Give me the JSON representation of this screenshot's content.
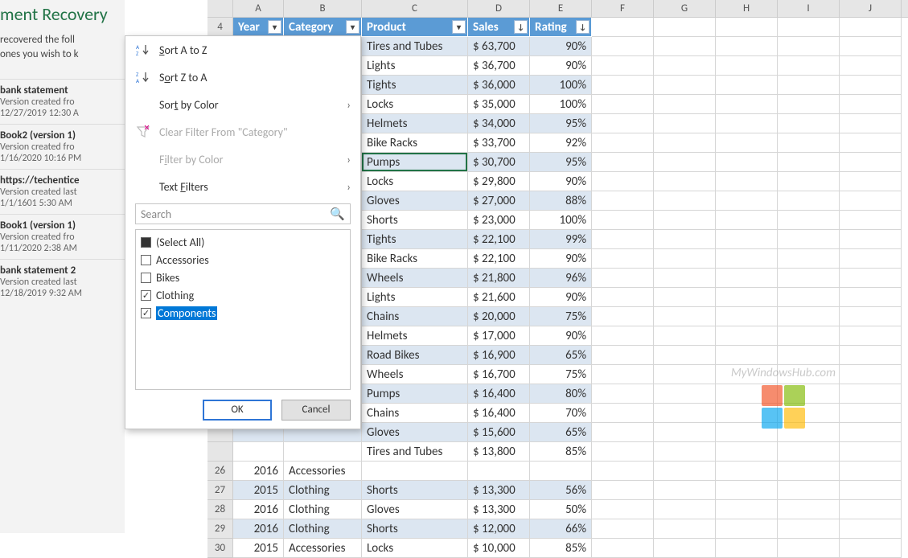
{
  "recovery": {
    "title": "ment Recovery",
    "desc1": "recovered the foll",
    "desc2": "ones you wish to k",
    "items": [
      {
        "title": "bank statement",
        "sub": "Version created fro",
        "date": "12/27/2019 12:30 A"
      },
      {
        "title": "Book2 (version 1)",
        "sub": "Version created fro",
        "date": "1/16/2020 10:16 PM"
      },
      {
        "title": "https://techentice",
        "sub": "Version created last",
        "date": "1/1/1601 5:30 AM"
      },
      {
        "title": "Book1 (version 1)",
        "sub": "Version created fro",
        "date": "1/11/2020 2:38 AM"
      },
      {
        "title": "bank statement 2",
        "sub": "Version created last",
        "date": "12/18/2019 9:32 AM"
      }
    ]
  },
  "columns_letters": [
    "A",
    "B",
    "C",
    "D",
    "E",
    "F",
    "G",
    "H",
    "I",
    "J"
  ],
  "headers": {
    "row_num": "4",
    "year": "Year",
    "category": "Category",
    "product": "Product",
    "sales": "Sales",
    "rating": "Rating"
  },
  "table_rows": [
    {
      "product": "Tires and Tubes",
      "sales": "$ 63,700",
      "rating": "90%"
    },
    {
      "product": "Lights",
      "sales": "$ 36,700",
      "rating": "90%"
    },
    {
      "product": "Tights",
      "sales": "$ 36,000",
      "rating": "100%"
    },
    {
      "product": "Locks",
      "sales": "$ 35,000",
      "rating": "100%"
    },
    {
      "product": "Helmets",
      "sales": "$ 34,000",
      "rating": "95%"
    },
    {
      "product": "Bike Racks",
      "sales": "$ 33,700",
      "rating": "92%"
    },
    {
      "product": "Pumps",
      "sales": "$ 30,700",
      "rating": "95%"
    },
    {
      "product": "Locks",
      "sales": "$ 29,800",
      "rating": "90%"
    },
    {
      "product": "Gloves",
      "sales": "$ 27,000",
      "rating": "88%"
    },
    {
      "product": "Shorts",
      "sales": "$ 23,000",
      "rating": "100%"
    },
    {
      "product": "Tights",
      "sales": "$ 22,100",
      "rating": "99%"
    },
    {
      "product": "Bike Racks",
      "sales": "$ 22,100",
      "rating": "90%"
    },
    {
      "product": "Wheels",
      "sales": "$ 21,800",
      "rating": "96%"
    },
    {
      "product": "Lights",
      "sales": "$ 21,600",
      "rating": "90%"
    },
    {
      "product": "Chains",
      "sales": "$ 20,000",
      "rating": "75%"
    },
    {
      "product": "Helmets",
      "sales": "$ 17,000",
      "rating": "90%"
    },
    {
      "product": "Road Bikes",
      "sales": "$ 16,900",
      "rating": "65%"
    },
    {
      "product": "Wheels",
      "sales": "$ 16,700",
      "rating": "75%"
    },
    {
      "product": "Pumps",
      "sales": "$ 16,400",
      "rating": "80%"
    },
    {
      "product": "Chains",
      "sales": "$ 16,400",
      "rating": "70%"
    },
    {
      "product": "Gloves",
      "sales": "$ 15,600",
      "rating": "65%"
    },
    {
      "product": "Tires and Tubes",
      "sales": "$ 13,800",
      "rating": "85%"
    }
  ],
  "visible_full_rows": [
    {
      "rownum": "26",
      "year": "2016",
      "category": "Accessories",
      "product": "",
      "sales": "",
      "rating": ""
    },
    {
      "rownum": "27",
      "year": "2015",
      "category": "Clothing",
      "product": "Shorts",
      "sales": "$ 13,300",
      "rating": "56%"
    },
    {
      "rownum": "28",
      "year": "2016",
      "category": "Clothing",
      "product": "Gloves",
      "sales": "$ 13,300",
      "rating": "50%"
    },
    {
      "rownum": "29",
      "year": "2016",
      "category": "Clothing",
      "product": "Shorts",
      "sales": "$ 12,000",
      "rating": "66%"
    },
    {
      "rownum": "30",
      "year": "2015",
      "category": "Accessories",
      "product": "Locks",
      "sales": "$ 10,000",
      "rating": "85%"
    }
  ],
  "filter_menu": {
    "sort_az": "Sort A to Z",
    "sort_za": "Sort Z to A",
    "sort_color": "Sort by Color",
    "clear": "Clear Filter From \"Category\"",
    "filter_color": "Filter by Color",
    "text_filters": "Text Filters",
    "search_placeholder": "Search",
    "items": {
      "select_all": "(Select All)",
      "accessories": "Accessories",
      "bikes": "Bikes",
      "clothing": "Clothing",
      "components": "Components"
    },
    "ok": "OK",
    "cancel": "Cancel"
  },
  "watermark": "MyWindowsHub.com"
}
